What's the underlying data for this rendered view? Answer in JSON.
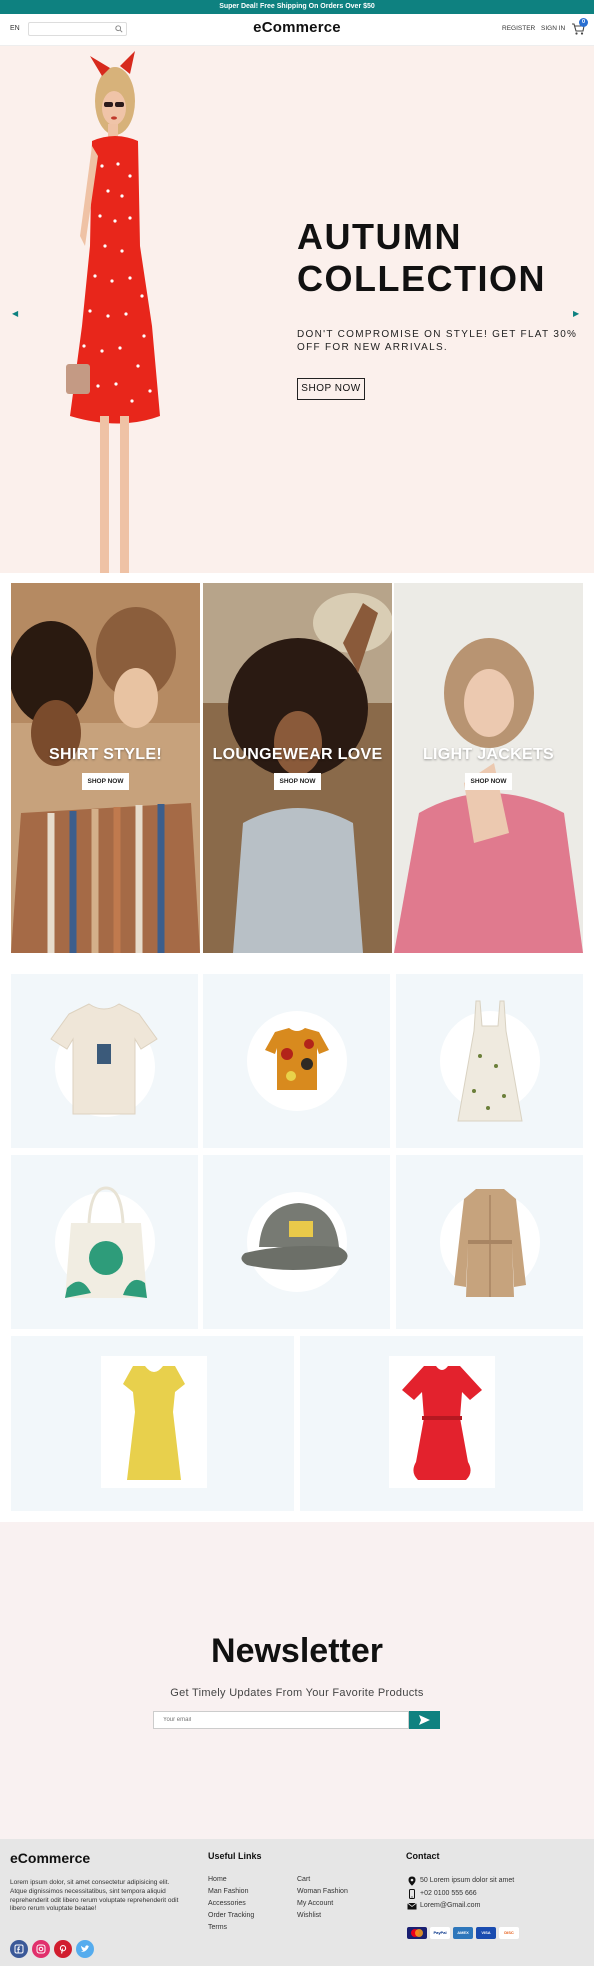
{
  "topbar": {
    "text": "Super Deal! Free Shipping On Orders Over $50"
  },
  "header": {
    "lang": "EN",
    "search_placeholder": "",
    "logo": "eCommerce",
    "register": "REGISTER",
    "signin": "SIGN IN",
    "cart_count": "0"
  },
  "hero": {
    "title_line1": "AUTUMN",
    "title_line2": "COLLECTION",
    "subtitle": "DON'T COMPROMISE ON STYLE! GET FLAT 30% OFF FOR NEW ARRIVALS.",
    "button": "SHOP NOW"
  },
  "categories": [
    {
      "title": "SHIRT STYLE!",
      "button": "SHOP NOW"
    },
    {
      "title": "LOUNGEWEAR LOVE",
      "button": "SHOP NOW"
    },
    {
      "title": "LIGHT JACKETS",
      "button": "SHOP NOW"
    }
  ],
  "products": [
    {
      "name": "t-shirt"
    },
    {
      "name": "hawaiian-shirt"
    },
    {
      "name": "floral-dress"
    },
    {
      "name": "tote-bag"
    },
    {
      "name": "cap"
    },
    {
      "name": "trench-coat"
    },
    {
      "name": "yellow-dress"
    },
    {
      "name": "red-dress"
    }
  ],
  "newsletter": {
    "title": "Newsletter",
    "subtitle": "Get Timely Updates From Your Favorite Products",
    "placeholder": "Your email"
  },
  "footer": {
    "brand": "eCommerce",
    "description": "Lorem ipsum dolor, sit amet consectetur adipisicing elit. Atque dignissimos necessitatibus, sint tempora aliquid reprehenderit odit libero rerum voluptate reprehenderit odit libero rerum voluptate beatae!",
    "useful_links_title": "Useful Links",
    "links_col1": [
      "Home",
      "Man Fashion",
      "Accessories",
      "Order Tracking",
      "Terms"
    ],
    "links_col2": [
      "Cart",
      "Woman Fashion",
      "My Account",
      "Wishlist"
    ],
    "contact_title": "Contact",
    "address": "50 Lorem ipsum dolor sit amet",
    "phone": "+02 0100 555 666",
    "email": "Lorem@Gmail.com",
    "payments": [
      "MasterCard",
      "PayPal",
      "Amex",
      "VISA",
      "Discover"
    ]
  },
  "colors": {
    "accent": "#0e8180",
    "hero_bg": "#fbf0ec",
    "product_bg": "#f2f7fa",
    "newsletter_bg": "#f9f1f1",
    "footer_bg": "#e6e6e6"
  }
}
